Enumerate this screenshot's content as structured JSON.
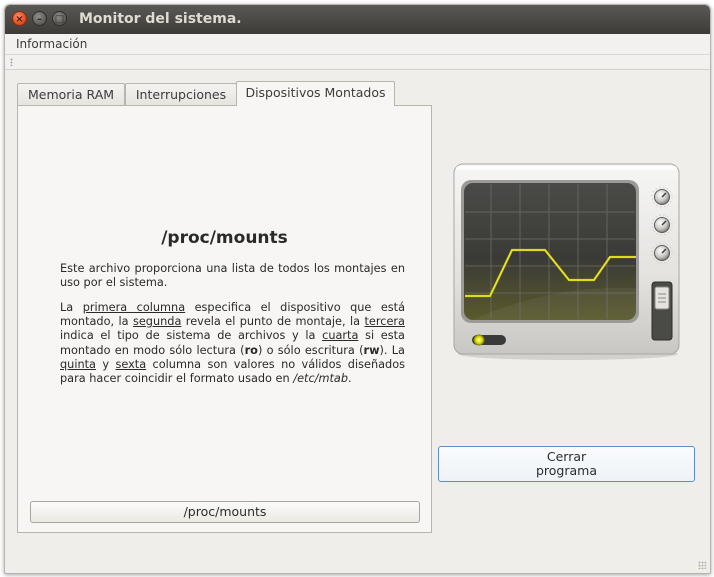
{
  "window": {
    "title": "Monitor del sistema.",
    "close_glyph": "×",
    "minimize_glyph": "–",
    "maximize_glyph": "□"
  },
  "menubar": {
    "items": [
      {
        "label": "Información"
      }
    ]
  },
  "tabs": [
    {
      "label": "Memoria RAM",
      "selected": false
    },
    {
      "label": "Interrupciones",
      "selected": false
    },
    {
      "label": "Dispositivos Montados",
      "selected": true
    }
  ],
  "content": {
    "title": "/proc/mounts",
    "paragraph1": "Este archivo proporciona una lista de todos los montajes en uso por el sistema.",
    "paragraph2": {
      "t1": "La ",
      "u1": "primera columna",
      "t2": " especifica el dispositivo que está montado, la ",
      "u2": "segunda",
      "t3": " revela el punto de montaje, la ",
      "u3": "tercera",
      "t4": " indica el tipo de sistema de archivos y la ",
      "u4": "cuarta",
      "t5": " si esta montado en modo sólo lectura (",
      "b1": "ro",
      "t6": ") o sólo escritura (",
      "b2": "rw",
      "t7": "). La ",
      "u5": "quinta",
      "t8": " y ",
      "u6": "sexta",
      "t9": " columna son valores no válidos diseñados para hacer coincidir el formato usado en ",
      "i1": "/etc/mtab",
      "t10": "."
    },
    "mounts_button_label": "/proc/mounts"
  },
  "sidebar": {
    "monitor_icon": "system-monitor-icon",
    "close_button_line1": "Cerrar",
    "close_button_line2": "programa"
  },
  "colors": {
    "titlebar": "#3c3b37",
    "close_button": "#e0461c",
    "window_bg": "#f0eeeb",
    "panel_bg": "#f7f6f5",
    "focus_border": "#5c8fc9",
    "graph_line": "#d4d000"
  }
}
